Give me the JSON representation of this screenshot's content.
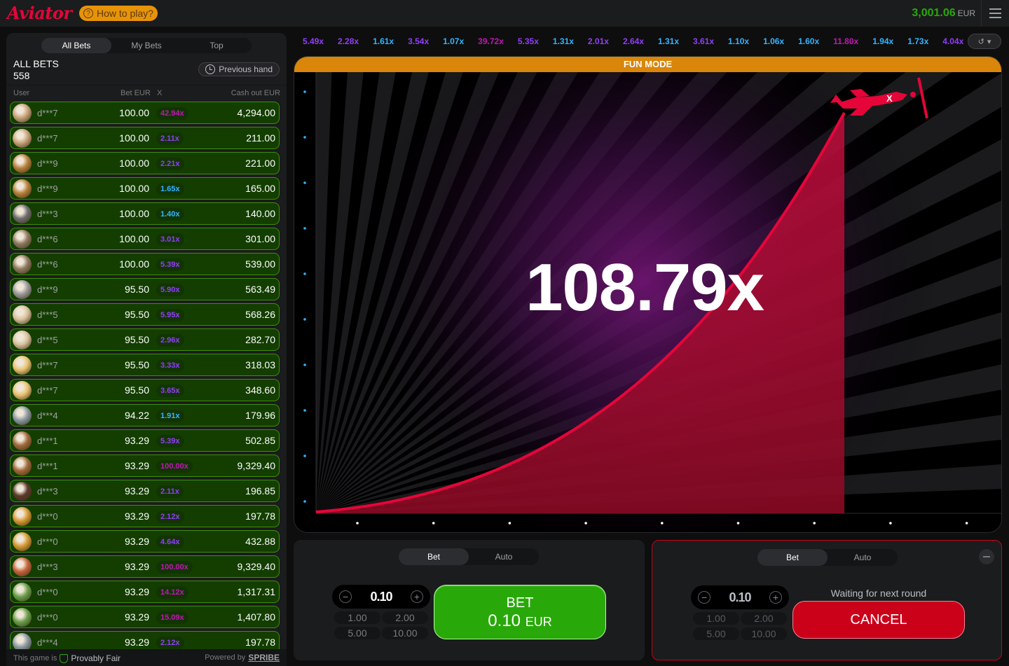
{
  "app": {
    "logo": "Aviator",
    "how_to_play": "How to play?",
    "balance": "3,001.06",
    "currency": "EUR"
  },
  "colors": {
    "accent_green": "#28a909",
    "accent_red": "#cb011a",
    "brand_red": "#e50539",
    "orange": "#e69308"
  },
  "bets_panel": {
    "tabs": [
      "All Bets",
      "My Bets",
      "Top"
    ],
    "active_tab": "All Bets",
    "title": "ALL BETS",
    "count": "558",
    "previous_hand": "Previous hand",
    "columns": {
      "user": "User",
      "bet": "Bet EUR",
      "x": "X",
      "cashout": "Cash out EUR"
    },
    "rows": [
      {
        "user": "d***7",
        "bet": "100.00",
        "mult": "42.94x",
        "cashout": "4,294.00",
        "mult_color": "#c017b4",
        "avatar": "#c9a57a"
      },
      {
        "user": "d***7",
        "bet": "100.00",
        "mult": "2.11x",
        "cashout": "211.00",
        "mult_color": "#913ef8",
        "avatar": "#c9a57a"
      },
      {
        "user": "d***9",
        "bet": "100.00",
        "mult": "2.21x",
        "cashout": "221.00",
        "mult_color": "#913ef8",
        "avatar": "#b7813a"
      },
      {
        "user": "d***9",
        "bet": "100.00",
        "mult": "1.65x",
        "cashout": "165.00",
        "mult_color": "#34b4ff",
        "avatar": "#b7813a"
      },
      {
        "user": "d***3",
        "bet": "100.00",
        "mult": "1.40x",
        "cashout": "140.00",
        "mult_color": "#34b4ff",
        "avatar": "#6e6e6e"
      },
      {
        "user": "d***6",
        "bet": "100.00",
        "mult": "3.01x",
        "cashout": "301.00",
        "mult_color": "#913ef8",
        "avatar": "#8e7a5e"
      },
      {
        "user": "d***6",
        "bet": "100.00",
        "mult": "5.39x",
        "cashout": "539.00",
        "mult_color": "#913ef8",
        "avatar": "#8e7a5e"
      },
      {
        "user": "d***9",
        "bet": "95.50",
        "mult": "5.90x",
        "cashout": "563.49",
        "mult_color": "#913ef8",
        "avatar": "#9a9a9a"
      },
      {
        "user": "d***5",
        "bet": "95.50",
        "mult": "5.95x",
        "cashout": "568.26",
        "mult_color": "#913ef8",
        "avatar": "#d8c29a"
      },
      {
        "user": "d***5",
        "bet": "95.50",
        "mult": "2.96x",
        "cashout": "282.70",
        "mult_color": "#913ef8",
        "avatar": "#d8c29a"
      },
      {
        "user": "d***7",
        "bet": "95.50",
        "mult": "3.33x",
        "cashout": "318.03",
        "mult_color": "#913ef8",
        "avatar": "#e8c36e"
      },
      {
        "user": "d***7",
        "bet": "95.50",
        "mult": "3.65x",
        "cashout": "348.60",
        "mult_color": "#913ef8",
        "avatar": "#e8c36e"
      },
      {
        "user": "d***4",
        "bet": "94.22",
        "mult": "1.91x",
        "cashout": "179.96",
        "mult_color": "#34b4ff",
        "avatar": "#8a9aa3"
      },
      {
        "user": "d***1",
        "bet": "93.29",
        "mult": "5.39x",
        "cashout": "502.85",
        "mult_color": "#913ef8",
        "avatar": "#a06a3a"
      },
      {
        "user": "d***1",
        "bet": "93.29",
        "mult": "100.00x",
        "cashout": "9,329.40",
        "mult_color": "#c017b4",
        "avatar": "#a06a3a"
      },
      {
        "user": "d***3",
        "bet": "93.29",
        "mult": "2.11x",
        "cashout": "196.85",
        "mult_color": "#913ef8",
        "avatar": "#5a3a2a"
      },
      {
        "user": "d***0",
        "bet": "93.29",
        "mult": "2.12x",
        "cashout": "197.78",
        "mult_color": "#913ef8",
        "avatar": "#d69b32"
      },
      {
        "user": "d***0",
        "bet": "93.29",
        "mult": "4.64x",
        "cashout": "432.88",
        "mult_color": "#913ef8",
        "avatar": "#d69b32"
      },
      {
        "user": "d***3",
        "bet": "93.29",
        "mult": "100.00x",
        "cashout": "9,329.40",
        "mult_color": "#c017b4",
        "avatar": "#c8643a"
      },
      {
        "user": "d***0",
        "bet": "93.29",
        "mult": "14.12x",
        "cashout": "1,317.31",
        "mult_color": "#c017b4",
        "avatar": "#6aa04a"
      },
      {
        "user": "d***0",
        "bet": "93.29",
        "mult": "15.09x",
        "cashout": "1,407.80",
        "mult_color": "#c017b4",
        "avatar": "#6aa04a"
      },
      {
        "user": "d***4",
        "bet": "93.29",
        "mult": "2.12x",
        "cashout": "197.78",
        "mult_color": "#913ef8",
        "avatar": "#8a9aa3"
      }
    ],
    "footer": {
      "provably_prefix": "This game is",
      "provably": "Provably Fair",
      "powered_prefix": "Powered by",
      "powered": "SPRIBE"
    }
  },
  "history": [
    {
      "v": "5.49x",
      "c": "#913ef8"
    },
    {
      "v": "2.28x",
      "c": "#913ef8"
    },
    {
      "v": "1.61x",
      "c": "#34b4ff"
    },
    {
      "v": "3.54x",
      "c": "#913ef8"
    },
    {
      "v": "1.07x",
      "c": "#34b4ff"
    },
    {
      "v": "39.72x",
      "c": "#c017b4"
    },
    {
      "v": "5.35x",
      "c": "#913ef8"
    },
    {
      "v": "1.31x",
      "c": "#34b4ff"
    },
    {
      "v": "2.01x",
      "c": "#913ef8"
    },
    {
      "v": "2.64x",
      "c": "#913ef8"
    },
    {
      "v": "1.31x",
      "c": "#34b4ff"
    },
    {
      "v": "3.61x",
      "c": "#913ef8"
    },
    {
      "v": "1.10x",
      "c": "#34b4ff"
    },
    {
      "v": "1.06x",
      "c": "#34b4ff"
    },
    {
      "v": "1.60x",
      "c": "#34b4ff"
    },
    {
      "v": "11.80x",
      "c": "#c017b4"
    },
    {
      "v": "1.94x",
      "c": "#34b4ff"
    },
    {
      "v": "1.73x",
      "c": "#34b4ff"
    },
    {
      "v": "4.04x",
      "c": "#913ef8"
    }
  ],
  "game": {
    "banner": "FUN MODE",
    "multiplier": "108.79x"
  },
  "bet_panel_1": {
    "tabs": [
      "Bet",
      "Auto"
    ],
    "active_tab": "Bet",
    "stake": "0.10",
    "chips": [
      "1.00",
      "2.00",
      "5.00",
      "10.00"
    ],
    "button_line1": "BET",
    "button_amount": "0.10",
    "button_currency": "EUR"
  },
  "bet_panel_2": {
    "tabs": [
      "Bet",
      "Auto"
    ],
    "active_tab": "Bet",
    "stake": "0.10",
    "chips": [
      "1.00",
      "2.00",
      "5.00",
      "10.00"
    ],
    "waiting": "Waiting for next round",
    "cancel": "CANCEL"
  }
}
